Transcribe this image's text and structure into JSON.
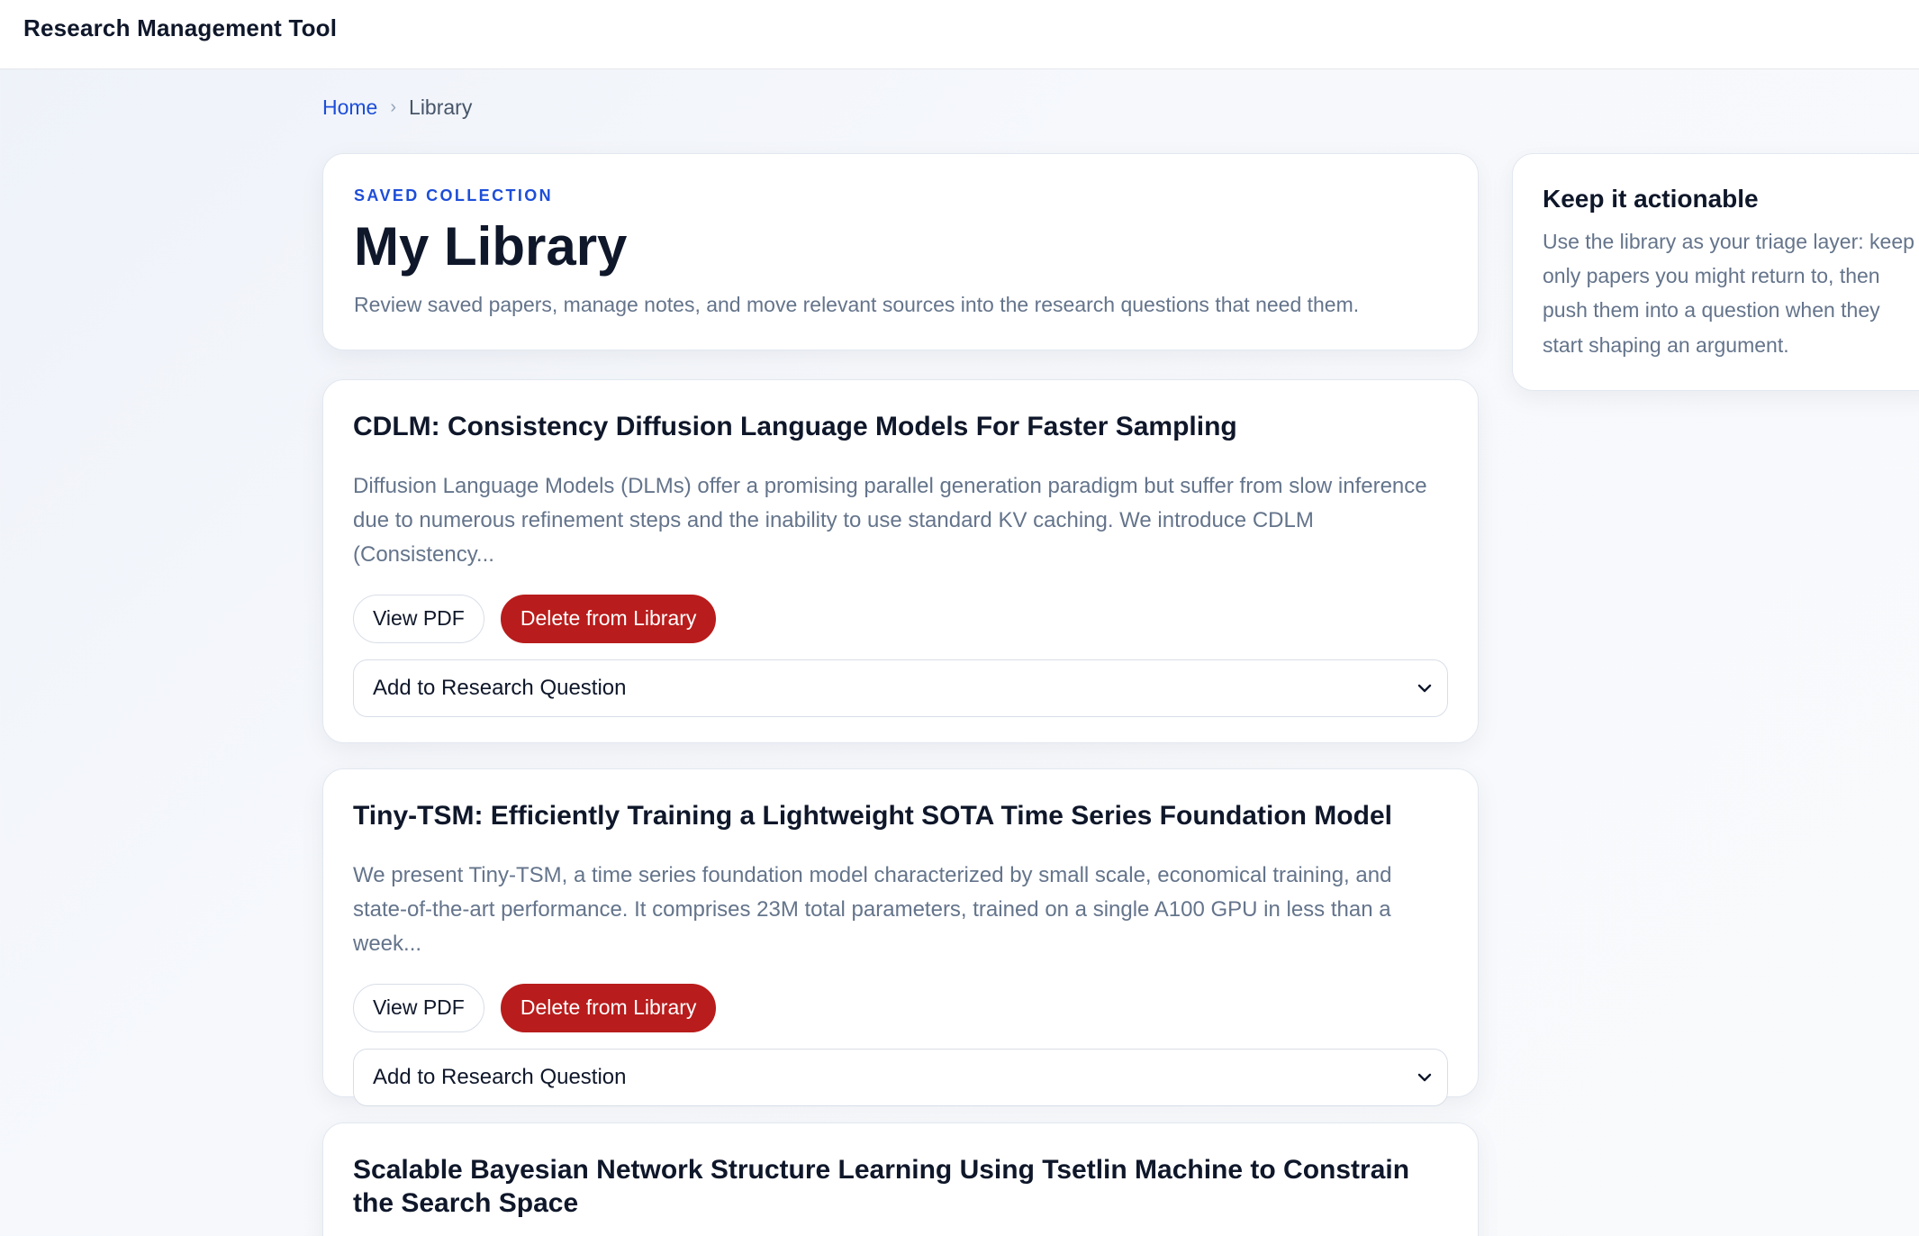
{
  "app": {
    "title": "Research Management Tool"
  },
  "breadcrumb": {
    "home": "Home",
    "separator": "›",
    "current": "Library"
  },
  "hero": {
    "eyebrow": "SAVED COLLECTION",
    "title": "My Library",
    "description": "Review saved papers, manage notes, and move relevant sources into the research questions that need them."
  },
  "papers": [
    {
      "title": "CDLM: Consistency Diffusion Language Models For Faster Sampling",
      "abstract": "Diffusion Language Models (DLMs) offer a promising parallel generation paradigm but suffer from slow inference due to numerous refinement steps and the inability to use standard KV caching. We introduce CDLM (Consistency...",
      "view_label": "View PDF",
      "delete_label": "Delete from Library",
      "select_value": "Add to Research Question"
    },
    {
      "title": "Tiny-TSM: Efficiently Training a Lightweight SOTA Time Series Foundation Model",
      "abstract": "We present Tiny-TSM, a time series foundation model characterized by small scale, economical training, and state-of-the-art performance. It comprises 23M total parameters, trained on a single A100 GPU in less than a week...",
      "view_label": "View PDF",
      "delete_label": "Delete from Library",
      "select_value": "Add to Research Question"
    },
    {
      "title": "Scalable Bayesian Network Structure Learning Using Tsetlin Machine to Constrain the Search Space"
    }
  ],
  "sidebar": {
    "title": "Keep it actionable",
    "text": "Use the library as your triage layer: keep only papers you might return to, then push them into a question when they start shaping an argument."
  },
  "icons": {
    "select_arrow": "chevron-down-icon"
  },
  "colors": {
    "accent": "#1d4ed8",
    "danger": "#b91c1c",
    "text": "#0f172a",
    "muted": "#64748b"
  }
}
